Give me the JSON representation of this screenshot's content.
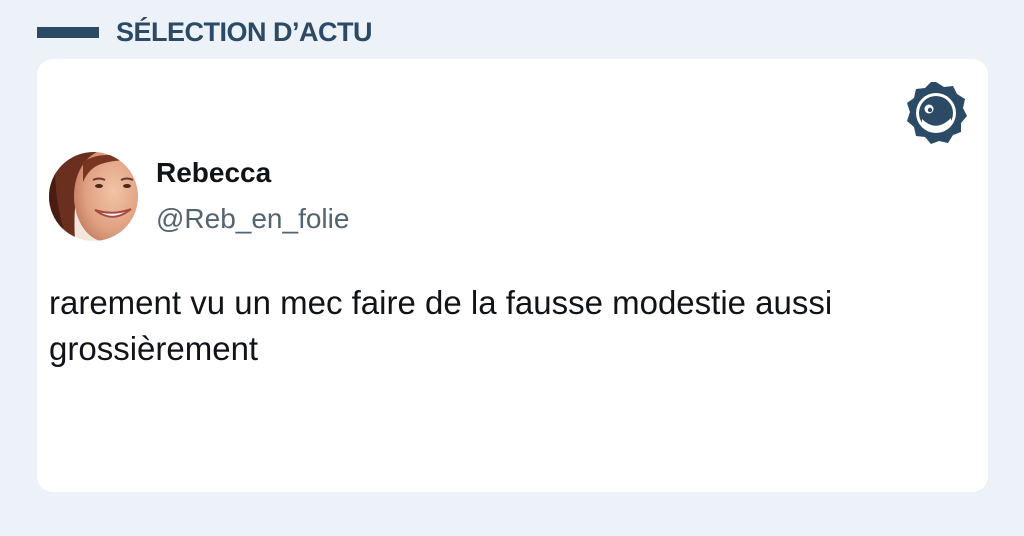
{
  "header": {
    "title": "SÉLECTION D’ACTU"
  },
  "tweet": {
    "author": {
      "name": "Rebecca",
      "handle": "@Reb_en_folie",
      "avatar_icon": "profile-photo"
    },
    "text": "rarement vu un mec faire de la fausse modestie aussi grossièrement",
    "brand_icon": "brand-logo-icon"
  },
  "colors": {
    "page_background": "#edf2f8",
    "accent": "#2b4a66",
    "card_background": "#ffffff",
    "text_primary": "#0f1419",
    "text_secondary": "#536471"
  }
}
